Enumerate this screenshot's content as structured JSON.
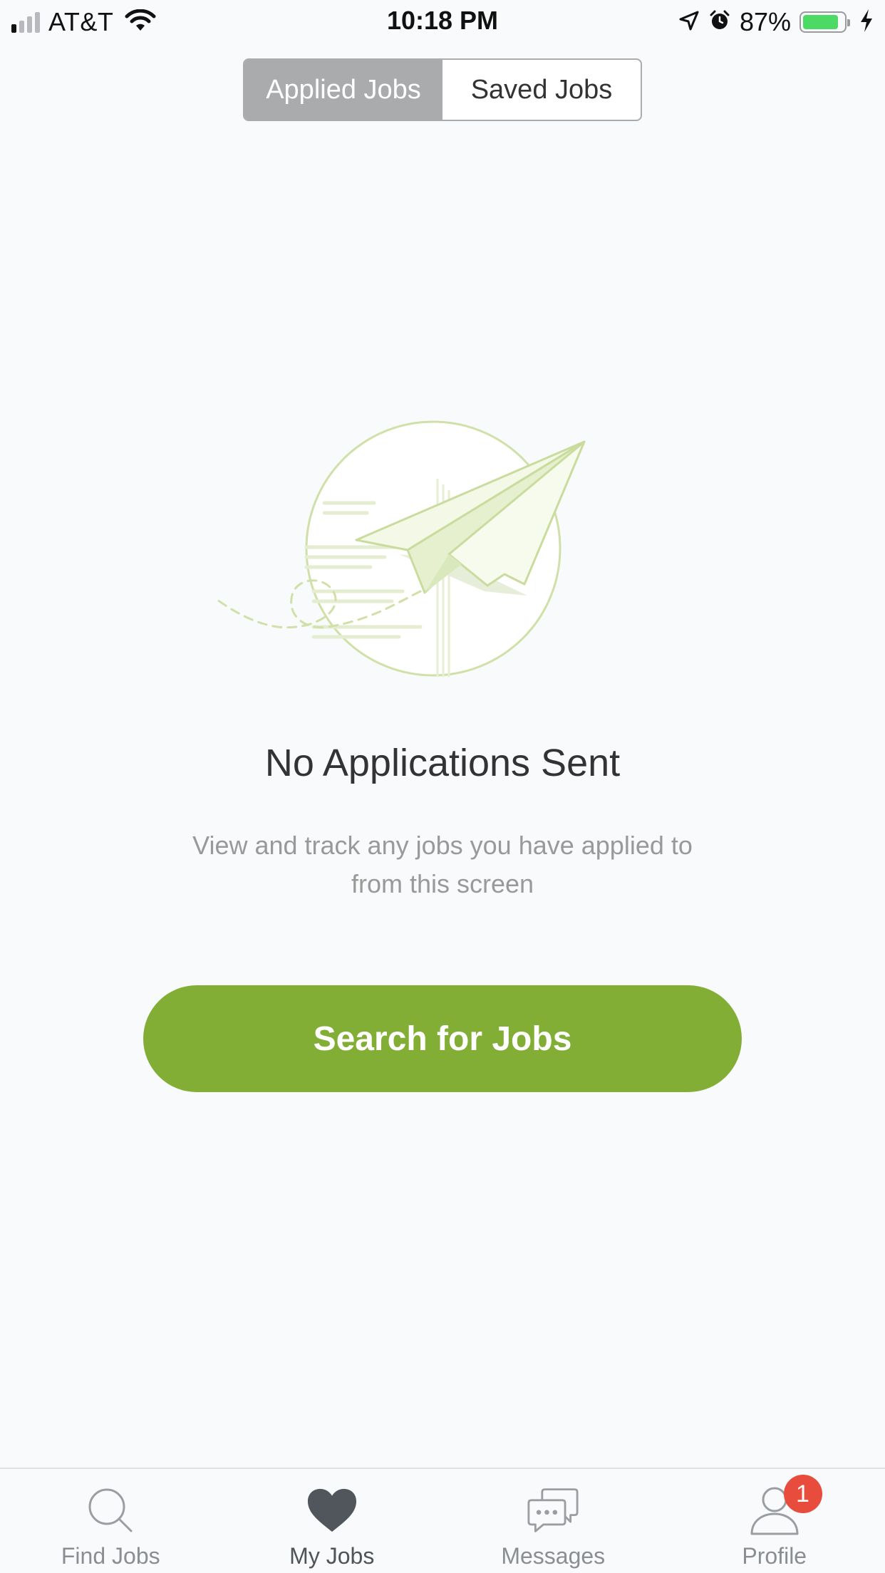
{
  "status_bar": {
    "carrier": "AT&T",
    "time": "10:18 PM",
    "battery_percent": "87%",
    "battery_level": 0.87,
    "signal_bars_active": 1,
    "icons": [
      "signal-icon",
      "wifi-icon",
      "location-arrow-icon",
      "alarm-icon",
      "battery-icon",
      "charging-bolt-icon"
    ]
  },
  "segmented_control": {
    "options": [
      "Applied Jobs",
      "Saved Jobs"
    ],
    "selected": "Applied Jobs"
  },
  "empty_state": {
    "illustration": "paper-plane-illustration",
    "title": "No Applications Sent",
    "subtitle": "View and track any jobs you have applied to from this screen"
  },
  "primary_action": {
    "label": "Search for Jobs"
  },
  "tab_bar": {
    "active": "My Jobs",
    "tabs": [
      {
        "label": "Find Jobs",
        "icon": "search-icon"
      },
      {
        "label": "My Jobs",
        "icon": "heart-icon"
      },
      {
        "label": "Messages",
        "icon": "chat-bubbles-icon"
      },
      {
        "label": "Profile",
        "icon": "person-icon",
        "badge": "1"
      }
    ]
  },
  "colors": {
    "accent_green": "#82ae35",
    "segment_active": "#a9abad",
    "badge_red": "#e74c3c",
    "background": "#f9fafb"
  }
}
